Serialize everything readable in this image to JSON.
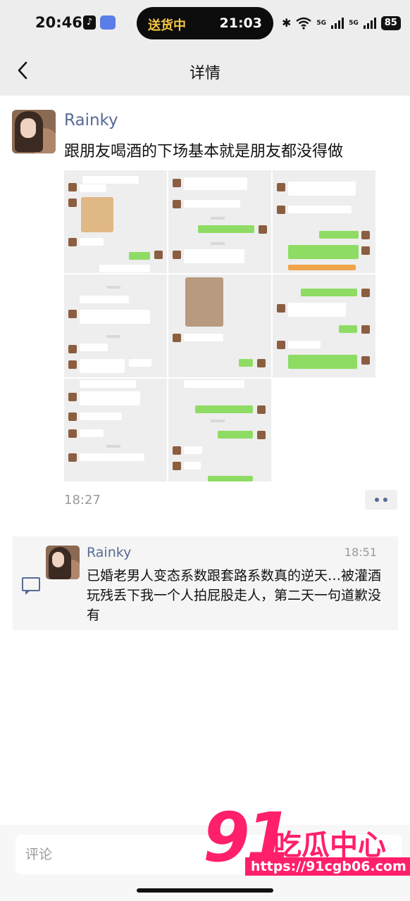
{
  "status_bar": {
    "time": "20:46",
    "live_activity_label": "送货中",
    "live_activity_time": "21:03",
    "network_label": "5G",
    "battery": "85"
  },
  "nav": {
    "title": "详情"
  },
  "post": {
    "author": "Rainky",
    "text": "跟朋友喝酒的下场基本就是朋友都没得做",
    "time": "18:27"
  },
  "comment": {
    "author": "Rainky",
    "time": "18:51",
    "text": "已婚老男人变态系数跟套路系数真的逆天…被灌酒玩残丢下我一个人拍屁股走人，第二天一句道歉没有"
  },
  "input": {
    "placeholder": "评论"
  },
  "watermark": {
    "logo": "91",
    "brand": "吃瓜中心",
    "url": "https://91cgb06.com"
  },
  "colors": {
    "link_blue": "#576b95",
    "wechat_green": "#8fdc64",
    "watermark_pink": "#ff1f6b"
  },
  "icons": [
    "back-chevron-icon",
    "comment-icon",
    "more-dots-icon",
    "wifi-icon",
    "bluetooth-icon"
  ]
}
